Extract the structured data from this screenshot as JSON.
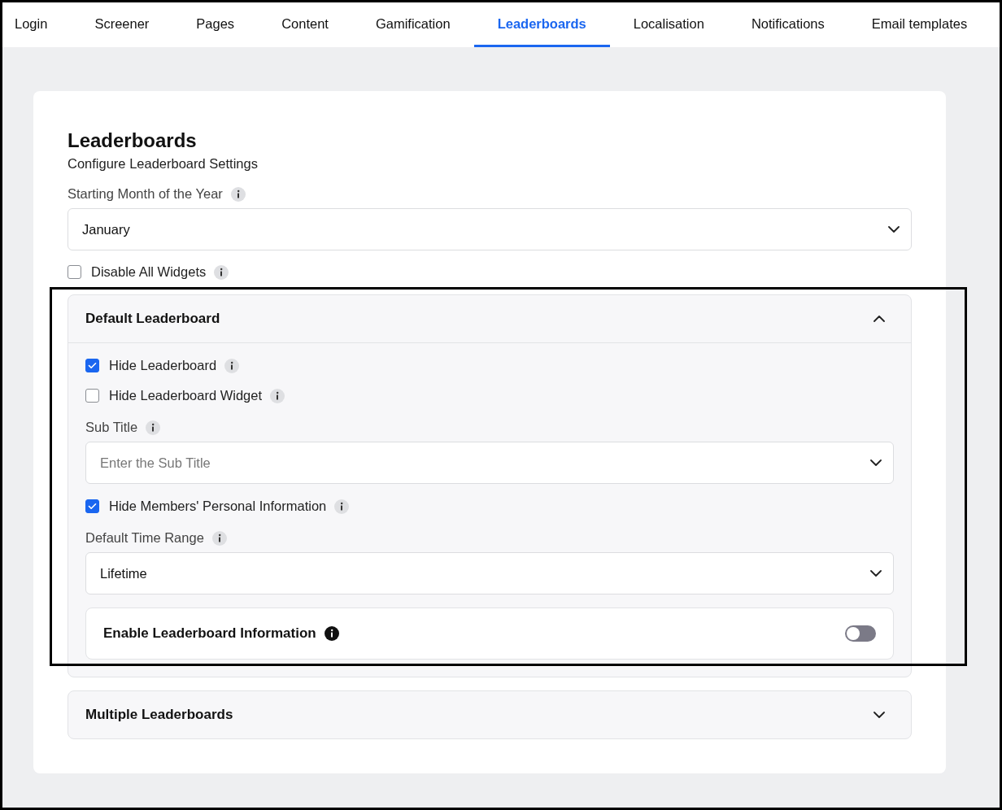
{
  "tabs": [
    {
      "label": "Login",
      "selected": false
    },
    {
      "label": "Screener",
      "selected": false
    },
    {
      "label": "Pages",
      "selected": false
    },
    {
      "label": "Content",
      "selected": false
    },
    {
      "label": "Gamification",
      "selected": false
    },
    {
      "label": "Leaderboards",
      "selected": true
    },
    {
      "label": "Localisation",
      "selected": false
    },
    {
      "label": "Notifications",
      "selected": false
    },
    {
      "label": "Email templates",
      "selected": false
    }
  ],
  "card": {
    "title": "Leaderboards",
    "subtitle": "Configure Leaderboard Settings",
    "fields": [
      {
        "kind": "select",
        "label": "Starting Month of the Year",
        "value": "January"
      },
      {
        "kind": "checkbox",
        "label": "Disable All Widgets",
        "checked": false
      }
    ],
    "sections": [
      {
        "title": "Default Leaderboard",
        "expanded": true,
        "highlighted": true,
        "items": [
          {
            "kind": "checkbox",
            "label": "Hide Leaderboard",
            "checked": true
          },
          {
            "kind": "checkbox",
            "label": "Hide Leaderboard Widget",
            "checked": false
          },
          {
            "kind": "select",
            "label": "Sub Title",
            "placeholder": "Enter the Sub Title"
          },
          {
            "kind": "checkbox",
            "label": "Hide Members' Personal Information",
            "checked": true
          },
          {
            "kind": "select",
            "label": "Default Time Range",
            "value": "Lifetime"
          },
          {
            "kind": "toggle",
            "label": "Enable Leaderboard Information",
            "on": false
          }
        ]
      },
      {
        "title": "Multiple Leaderboards",
        "expanded": false,
        "highlighted": false
      }
    ]
  }
}
